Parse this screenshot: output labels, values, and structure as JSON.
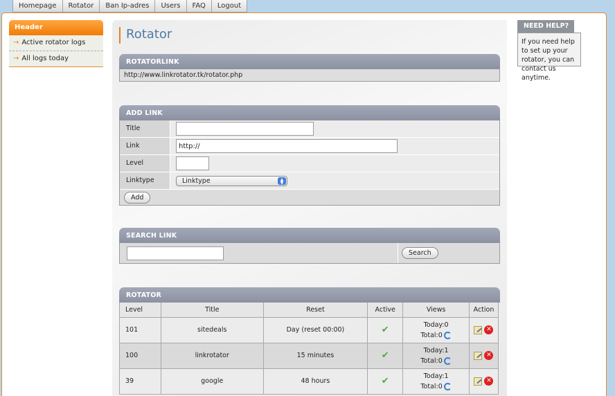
{
  "nav": [
    "Homepage",
    "Rotator",
    "Ban Ip-adres",
    "Users",
    "FAQ",
    "Logout"
  ],
  "sidebar": {
    "header": "Header",
    "items": [
      "Active rotator logs",
      "All logs today"
    ]
  },
  "page": {
    "title": "Rotator"
  },
  "rotatorlink": {
    "heading": "ROTATORLINK",
    "url": "http://www.linkrotator.tk/rotator.php"
  },
  "add_link": {
    "heading": "ADD LINK",
    "fields": {
      "title_label": "Title",
      "link_label": "Link",
      "link_value": "http://",
      "level_label": "Level",
      "linktype_label": "Linktype",
      "linktype_selected": "Linktype"
    },
    "add_button": "Add"
  },
  "search_link": {
    "heading": "SEARCH LINK",
    "search_button": "Search"
  },
  "rotator": {
    "heading": "ROTATOR",
    "columns": [
      "Level",
      "Title",
      "Reset",
      "Active",
      "Views",
      "Action"
    ],
    "rows": [
      {
        "level": "101",
        "title": "sitedeals",
        "reset": "Day (reset 00:00)",
        "today": "Today:0",
        "total": "Total:0"
      },
      {
        "level": "100",
        "title": "linkrotator",
        "reset": "15 minutes",
        "today": "Today:1",
        "total": "Total:0"
      },
      {
        "level": "39",
        "title": "google",
        "reset": "48 hours",
        "today": "Today:1",
        "total": "Total:0"
      }
    ]
  },
  "help": {
    "heading": "NEED HELP?",
    "text": "If you need help to set up your rotator, you can contact us anytime."
  },
  "colors": {
    "accent": "#f07c06",
    "panel_header": "#8b91a2",
    "background": "#b7d4ea",
    "title": "#4d7ba8"
  }
}
